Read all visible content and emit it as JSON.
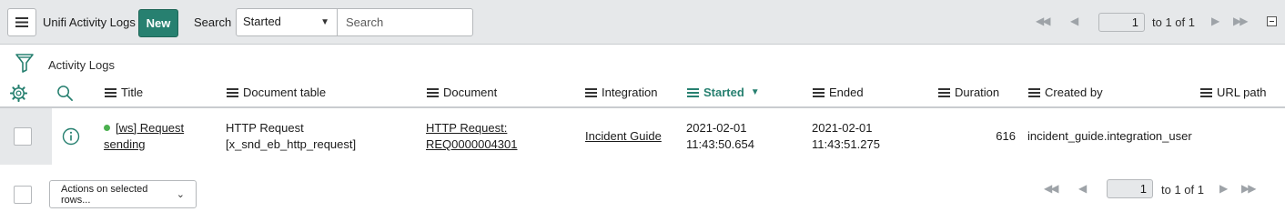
{
  "header": {
    "menu_icon": "hamburger-icon",
    "list_title": "Unifi Activity Logs",
    "new_label": "New",
    "search_label": "Search",
    "search_field": "Started",
    "search_placeholder": "Search"
  },
  "pagination": {
    "first_icon": "first-page-icon",
    "prev_icon": "previous-page-icon",
    "current_page": "1",
    "range_text": "to 1 of 1",
    "next_icon": "next-page-icon",
    "last_icon": "last-page-icon"
  },
  "breadcrumb": {
    "filter_icon": "funnel-icon",
    "label": "Activity Logs"
  },
  "columns": [
    {
      "label": "Title"
    },
    {
      "label": "Document table"
    },
    {
      "label": "Document"
    },
    {
      "label": "Integration"
    },
    {
      "label": "Started",
      "sorted": "descending"
    },
    {
      "label": "Ended"
    },
    {
      "label": "Duration"
    },
    {
      "label": "Created by"
    },
    {
      "label": "URL path"
    }
  ],
  "rows": [
    {
      "title_line1": "[ws] Request",
      "title_line2": "sending",
      "status_color": "#4bb04f",
      "document_table_line1": "HTTP Request",
      "document_table_line2": "[x_snd_eb_http_request]",
      "document_line1": "HTTP Request:",
      "document_line2": "REQ0000004301",
      "integration": "Incident Guide",
      "started_date": "2021-02-01",
      "started_time": "11:43:50.654",
      "ended_date": "2021-02-01",
      "ended_time": "11:43:51.275",
      "duration": "616",
      "created_by": "incident_guide.integration_user",
      "url_path": ""
    }
  ],
  "footer": {
    "actions_label": "Actions on selected rows...",
    "current_page": "1",
    "range_text": "to 1 of 1"
  },
  "colors": {
    "accent": "#278070",
    "header_bg": "#e6e8ea",
    "status_ok": "#4bb04f"
  }
}
